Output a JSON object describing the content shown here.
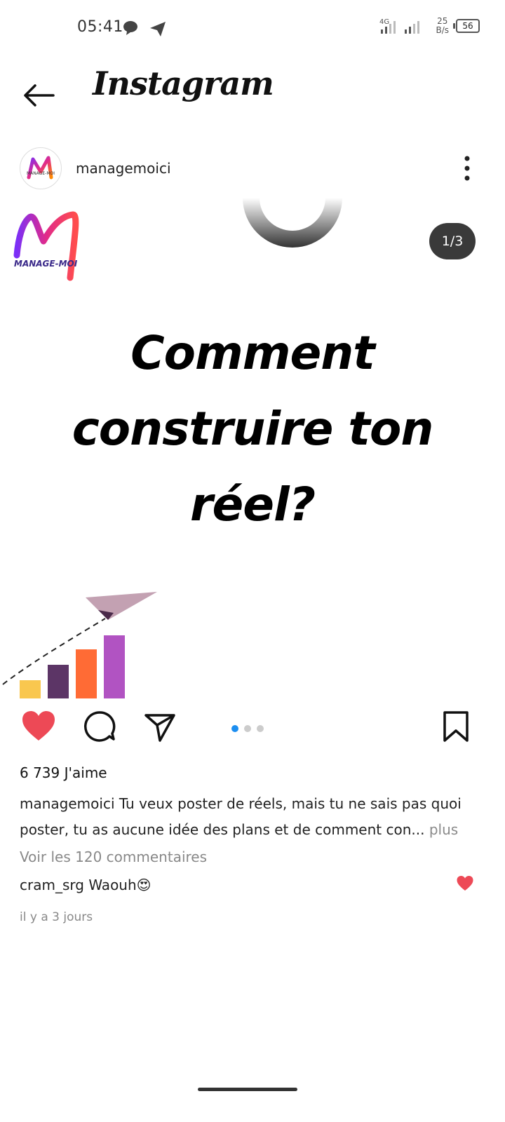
{
  "status_bar": {
    "time": "05:41",
    "net_speed_value": "25",
    "net_speed_unit": "B/s",
    "battery": "56",
    "network": "4G"
  },
  "header": {
    "title": "Instagram"
  },
  "post": {
    "username": "managemoici",
    "avatar_brand": "MANAGE-MOI",
    "logo_text": "MANAGE-MOI",
    "slide_counter": "1/3",
    "headline_line1": "Comment",
    "headline_line2": "construire ton",
    "headline_line3": "réel?",
    "slide_index": 1,
    "slide_total": 3,
    "chart_bar_colors": [
      "#f9c74f",
      "#5c3566",
      "#ff6b35",
      "#b153c2"
    ],
    "likes": "6 739 J'aime",
    "caption_user": "managemoici",
    "caption_text": "Tu veux poster de réels, mais tu ne sais pas quoi poster, tu as aucune idée des plans et de comment con...",
    "caption_more": "plus",
    "view_comments": "Voir les 120 commentaires",
    "comment_user": "cram_srg",
    "comment_text": "Waouh😍",
    "time_ago": "il y a 3 jours",
    "like_color": "#ed4956",
    "dot_active_color": "#1d8ef0"
  }
}
